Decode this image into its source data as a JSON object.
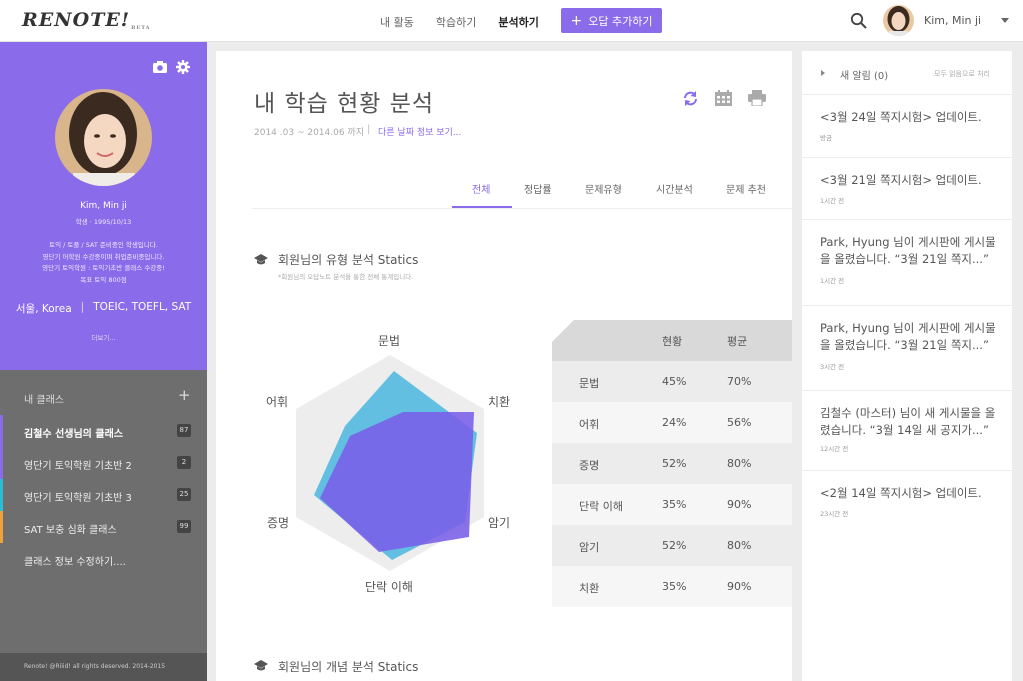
{
  "topbar": {
    "logo": "RENOTE!",
    "logo_sub": "BETA",
    "nav": [
      "내 활동",
      "학습하기",
      "분석하기"
    ],
    "add_button": "오답 추가하기",
    "user_name": "Kim, Min ji"
  },
  "profile": {
    "name": "Kim, Min ji",
    "birth": "학생 · 1995/10/13",
    "bio": [
      "토익 / 토플 / SAT 준비중인 학생입니다.",
      "영단기 어학원 수강중이며 취업준비중입니다.",
      "영단기 토익학원 : 토익기초반 클래스 수강중!",
      "목표 토익 800점"
    ],
    "location": "서울, Korea",
    "tags": "TOEIC, TOEFL, SAT",
    "more": "더보기..."
  },
  "classes": {
    "heading": "내 클래스",
    "items": [
      {
        "label": "김철수 선생님의 클래스",
        "count": "87",
        "color": "#8a6bea",
        "active": true
      },
      {
        "label": "영단기 토익학원 기초반 2",
        "count": "2",
        "color": "#8a6bea",
        "active": false
      },
      {
        "label": "영단기 토익학원 기초반 3",
        "count": "25",
        "color": "#2bbcd8",
        "active": false
      },
      {
        "label": "SAT 보충 심화 클래스",
        "count": "99",
        "color": "#f0a23a",
        "active": false
      },
      {
        "label": "클래스 정보 수정하기....",
        "count": "",
        "color": "",
        "active": false
      }
    ],
    "footer": "Renote! @Riiid! all rights deserved. 2014-2015"
  },
  "main": {
    "title": "내 학습 현황 분석",
    "date_range": "2014 .03 ~ 2014.06 까지",
    "date_sep": "|",
    "other_date": "다른 날짜 정보 보기...",
    "tabs": [
      "전체",
      "정답률",
      "문제유형",
      "시간분석",
      "문제 추천"
    ],
    "section1": {
      "title": "회원님의 유형 분석 Statics",
      "sub": "*회원님의 오답노트 분석을 통한 전체 통계입니다."
    },
    "section2": {
      "title": "회원님의 개념 분석 Statics"
    },
    "radar_labels": [
      "문법",
      "치환",
      "암기",
      "단락 이해",
      "증명",
      "어휘"
    ],
    "table": {
      "headers": [
        "현황",
        "평균"
      ],
      "rows": [
        {
          "name": "문법",
          "current": "45%",
          "average": "70%"
        },
        {
          "name": "어휘",
          "current": "24%",
          "average": "56%"
        },
        {
          "name": "증명",
          "current": "52%",
          "average": "80%"
        },
        {
          "name": "단락 이해",
          "current": "35%",
          "average": "90%"
        },
        {
          "name": "암기",
          "current": "52%",
          "average": "80%"
        },
        {
          "name": "치환",
          "current": "35%",
          "average": "90%"
        }
      ]
    }
  },
  "notifications": {
    "title": "새 알림 (0)",
    "read_all": "모두 읽음으로 처리",
    "items": [
      {
        "text": "<3월 24일 쪽지시험> 업데이트.",
        "time": "방금"
      },
      {
        "text": "<3월 21일 쪽지시험> 업데이트.",
        "time": "1시간 전"
      },
      {
        "text": "Park, Hyung 님이 게시판에 게시물을 올렸습니다. “3월 21일 쪽지...”",
        "time": "1시간 전"
      },
      {
        "text": "Park, Hyung 님이 게시판에 게시물을 올렸습니다. “3월 21일 쪽지...”",
        "time": "3시간 전"
      },
      {
        "text": "김철수 (마스터) 님이 새 게시물을 올렸습니다. “3월 14일 새 공지가...”",
        "time": "12시간 전"
      },
      {
        "text": "<2월 14일 쪽지시험> 업데이트.",
        "time": "23시간 전"
      }
    ]
  },
  "colors": {
    "accent": "#8a6bea",
    "cyan": "#2bbcd8",
    "orange": "#f0a23a"
  }
}
